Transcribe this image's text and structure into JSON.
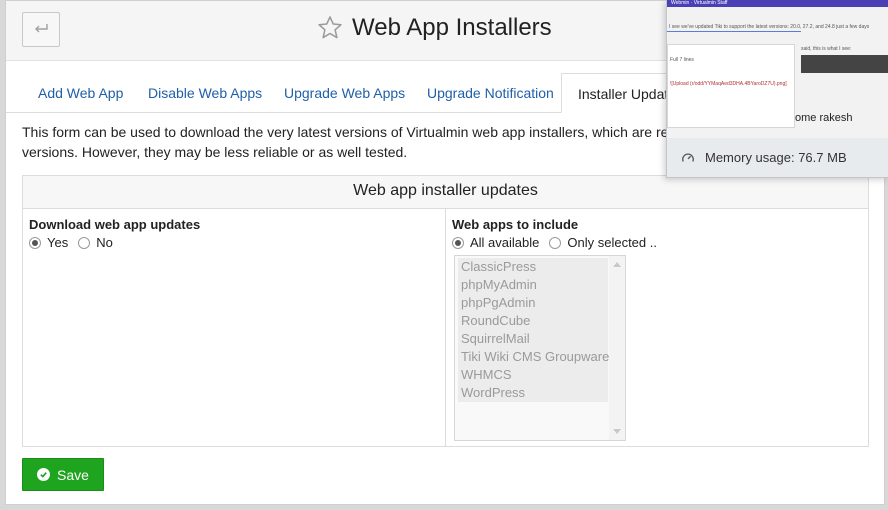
{
  "header": {
    "back_icon": "return-arrow-icon",
    "star_icon": "star-icon",
    "title": "Web App Installers"
  },
  "tabs": [
    {
      "label": "Add Web App"
    },
    {
      "label": "Disable Web Apps"
    },
    {
      "label": "Upgrade Web Apps"
    },
    {
      "label": "Upgrade Notification"
    },
    {
      "label": "Installer Updates"
    }
  ],
  "description": {
    "line1": "This form can be used to download the very latest versions of Virtualmin web app installers, which are released s",
    "line2": "versions. However, they may be less reliable or as well tested."
  },
  "form": {
    "heading": "Web app installer updates",
    "download": {
      "label": "Download web app updates",
      "options": [
        "Yes",
        "No"
      ],
      "selected": "Yes"
    },
    "include": {
      "label": "Web apps to include",
      "options": [
        "All available",
        "Only selected .."
      ],
      "selected": "All available",
      "apps": [
        "ClassicPress",
        "phpMyAdmin",
        "phpPgAdmin",
        "RoundCube",
        "SquirrelMail",
        "Tiki Wiki CMS Groupware",
        "WHMCS",
        "WordPress"
      ]
    }
  },
  "save_button": {
    "label": "Save",
    "icon": "check-circle-icon"
  },
  "colors": {
    "accent": "#1f5fa8",
    "save": "#1ea41e"
  },
  "overlay": {
    "thumb_header": "Webmin · Virtualmin Staff",
    "thumb_line": "I see we've updated Tiki to support the latest versions: 20.0, 27.2, and 24.8 just a few days ago",
    "thumb_reply": "Full 7 lines",
    "thumb_link": "![Upload (r/odd/YYMaqAed3DHA.4BYaroDZ7U).png]",
    "thumb_side": "said, this is what I see:",
    "thumb_peek": "ome rakesh",
    "memory_label": "Memory usage: 76.7 MB",
    "memory_icon": "gauge-icon"
  }
}
